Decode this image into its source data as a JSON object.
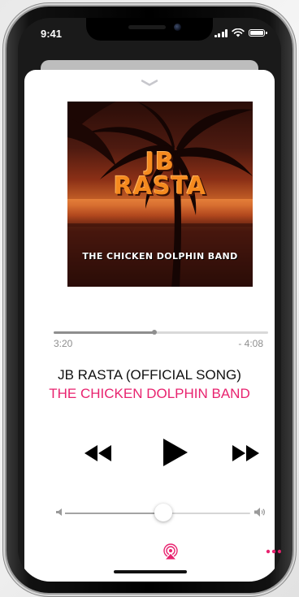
{
  "status_bar": {
    "time": "9:41"
  },
  "artwork": {
    "title": "JB\nRASTA",
    "band_text": "THE CHICKEN DOLPHIN BAND"
  },
  "playback": {
    "elapsed": "3:20",
    "remaining": "- 4:08",
    "progress_percent": 47
  },
  "track": {
    "title": "JB RASTA (OFFICIAL SONG)",
    "artist": "THE CHICKEN DOLPHIN BAND"
  },
  "volume": {
    "level_percent": 53
  },
  "icons": {
    "collapse": "chevron-down-icon",
    "rewind": "rewind-icon",
    "play": "play-icon",
    "forward": "fast-forward-icon",
    "volume_low": "speaker-low-icon",
    "volume_high": "speaker-high-icon",
    "airplay": "airplay-icon",
    "more": "more-icon"
  },
  "colors": {
    "accent": "#e8236f",
    "progress": "#8e8e8e"
  }
}
